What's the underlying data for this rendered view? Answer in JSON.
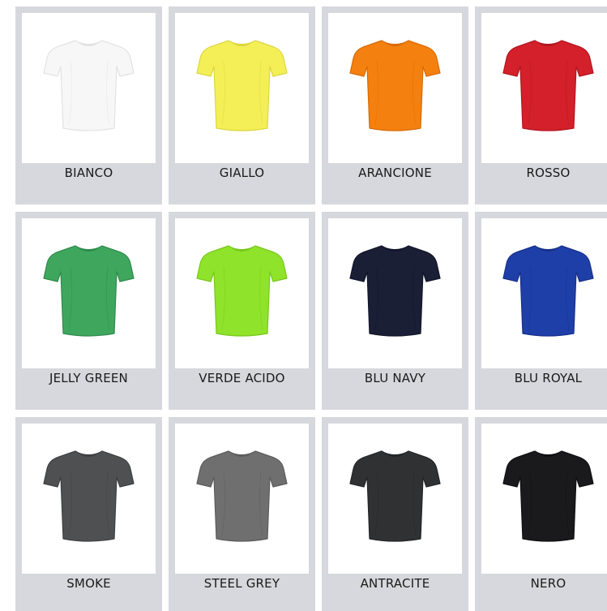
{
  "swatches": [
    {
      "name": "BIANCO",
      "color": "#f7f7f7",
      "shade": "#e2e2e2"
    },
    {
      "name": "GIALLO",
      "color": "#f4ef56",
      "shade": "#dcd63e"
    },
    {
      "name": "ARANCIONE",
      "color": "#f4800f",
      "shade": "#d86b05"
    },
    {
      "name": "ROSSO",
      "color": "#d3202a",
      "shade": "#b1161f"
    },
    {
      "name": "JELLY GREEN",
      "color": "#3fa65e",
      "shade": "#2f8a4b"
    },
    {
      "name": "VERDE ACIDO",
      "color": "#8fe32a",
      "shade": "#78c71d"
    },
    {
      "name": "BLU NAVY",
      "color": "#1b1f36",
      "shade": "#12152a"
    },
    {
      "name": "BLU ROYAL",
      "color": "#1f3fa8",
      "shade": "#16308a"
    },
    {
      "name": "SMOKE",
      "color": "#4e5052",
      "shade": "#3d3f41"
    },
    {
      "name": "STEEL GREY",
      "color": "#6f6f70",
      "shade": "#5c5c5d"
    },
    {
      "name": "ANTRACITE",
      "color": "#2f3133",
      "shade": "#232527"
    },
    {
      "name": "NERO",
      "color": "#1a1a1c",
      "shade": "#101012"
    }
  ]
}
